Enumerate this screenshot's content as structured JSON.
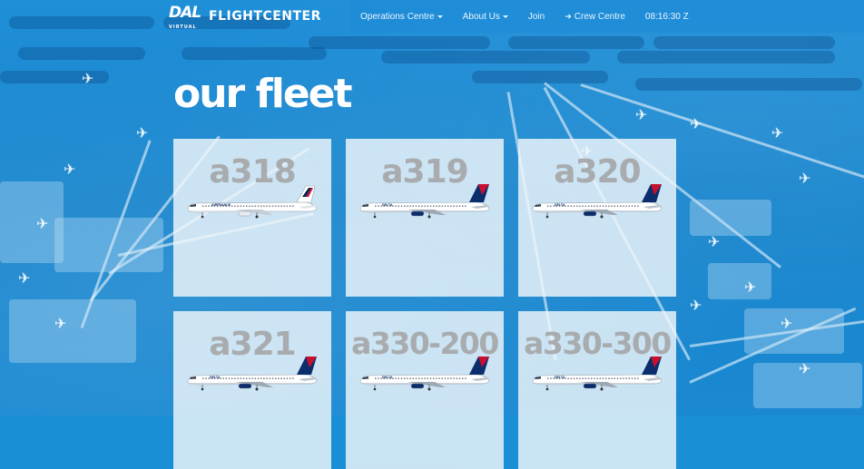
{
  "brand": {
    "logo_text": "DAL",
    "logo_sub": "VIRTUAL",
    "name": "FLIGHTCENTER"
  },
  "nav": {
    "items": [
      {
        "label": "Operations Centre",
        "dropdown": true,
        "icon": null
      },
      {
        "label": "About Us",
        "dropdown": true,
        "icon": null
      },
      {
        "label": "Join",
        "dropdown": false,
        "icon": null
      },
      {
        "label": "Crew Centre",
        "dropdown": false,
        "icon": "sign-in-icon"
      }
    ],
    "clock": "08:16:30 Z"
  },
  "page": {
    "title": "our fleet"
  },
  "fleet": [
    {
      "name": "a318",
      "livery": "airfrance",
      "text": "AIRFRANCE"
    },
    {
      "name": "a319",
      "livery": "delta",
      "text": "DELTA"
    },
    {
      "name": "a320",
      "livery": "delta",
      "text": "DELTA"
    },
    {
      "name": "a321",
      "livery": "delta",
      "text": "DELTA"
    },
    {
      "name": "a330-200",
      "livery": "delta",
      "text": "DELTA"
    },
    {
      "name": "a330-300",
      "livery": "delta",
      "text": "DELTA"
    }
  ],
  "colors": {
    "background": "#1a8fd6",
    "nav_panel": "#1e8cd7",
    "title": "#ffffff",
    "card_bg": "#f0f6fa",
    "card_label": "#a8acaf",
    "delta_red": "#c8102e",
    "delta_navy": "#0b2d6b",
    "airfrance_blue": "#002157"
  }
}
